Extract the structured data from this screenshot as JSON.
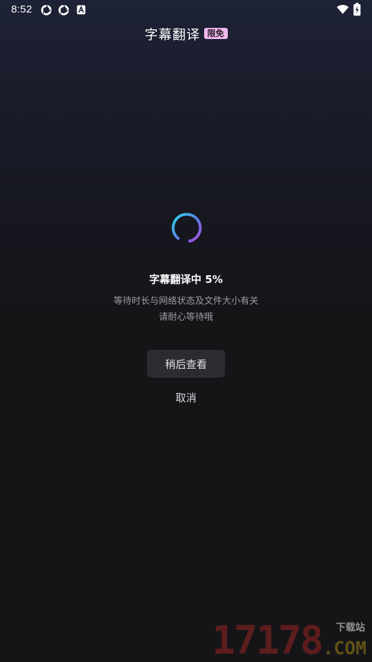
{
  "status_bar": {
    "time": "8:52",
    "icons": [
      "aperture-icon",
      "aperture-icon",
      "a-notification-icon",
      "wifi-icon",
      "battery-charging-icon"
    ]
  },
  "header": {
    "title": "字幕翻译",
    "badge": "限免"
  },
  "progress": {
    "title": "字幕翻译中 5%",
    "percent": 5,
    "hint_line1": "等待时长与网络状态及文件大小有关",
    "hint_line2": "请耐心等待哦"
  },
  "actions": {
    "later_label": "稍后查看",
    "cancel_label": "取消"
  },
  "watermark": {
    "digits": "17178",
    "com": ".COM",
    "sub": "下载站"
  },
  "colors": {
    "badge_bg": "#f0b8ef",
    "spinner_start": "#2fd6e8",
    "spinner_end": "#b04ce0",
    "button_bg": "#2b2c31"
  }
}
